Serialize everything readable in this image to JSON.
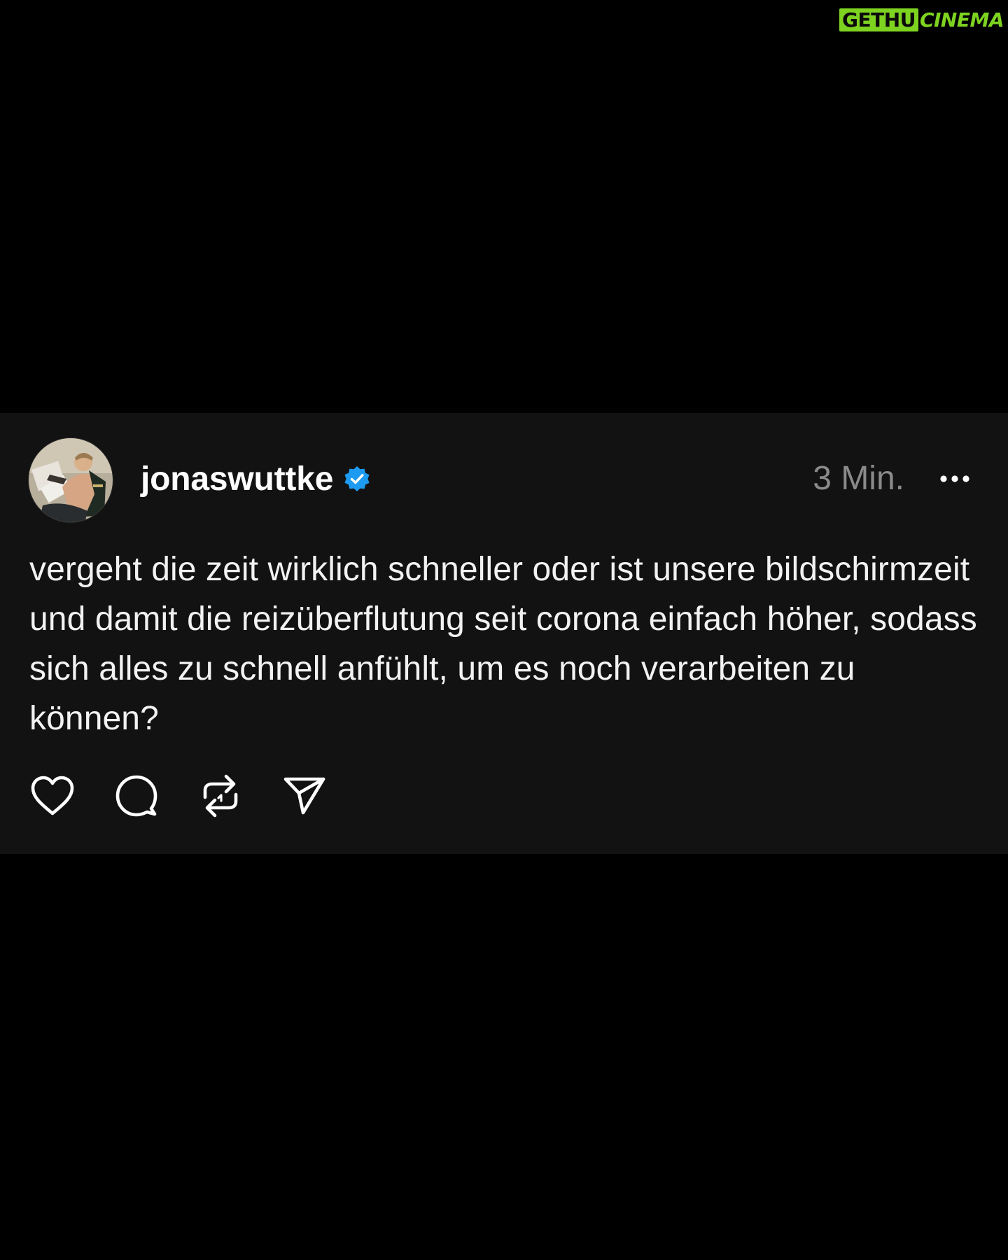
{
  "watermark": {
    "part1": "GETHU",
    "part2": "CINEMA",
    "color": "#7ed321"
  },
  "post": {
    "author": {
      "username": "jonaswuttke",
      "verified": true,
      "verified_icon": "verified-badge-icon",
      "verified_color": "#1d9bf0"
    },
    "timestamp": "3 Min.",
    "text": "vergeht die zeit wirklich schneller oder ist unsere bildschirmzeit und damit die reizüberflutung seit corona einfach höher, sodass sich alles zu schnell anfühlt, um es noch verarbeiten zu können?",
    "actions": [
      {
        "name": "like",
        "icon": "heart-icon"
      },
      {
        "name": "reply",
        "icon": "comment-icon"
      },
      {
        "name": "repost",
        "icon": "repost-icon"
      },
      {
        "name": "share",
        "icon": "send-icon"
      }
    ]
  },
  "colors": {
    "page_background": "#000000",
    "card_background": "#121212",
    "text": "#ffffff",
    "muted": "#8a8a8a"
  }
}
